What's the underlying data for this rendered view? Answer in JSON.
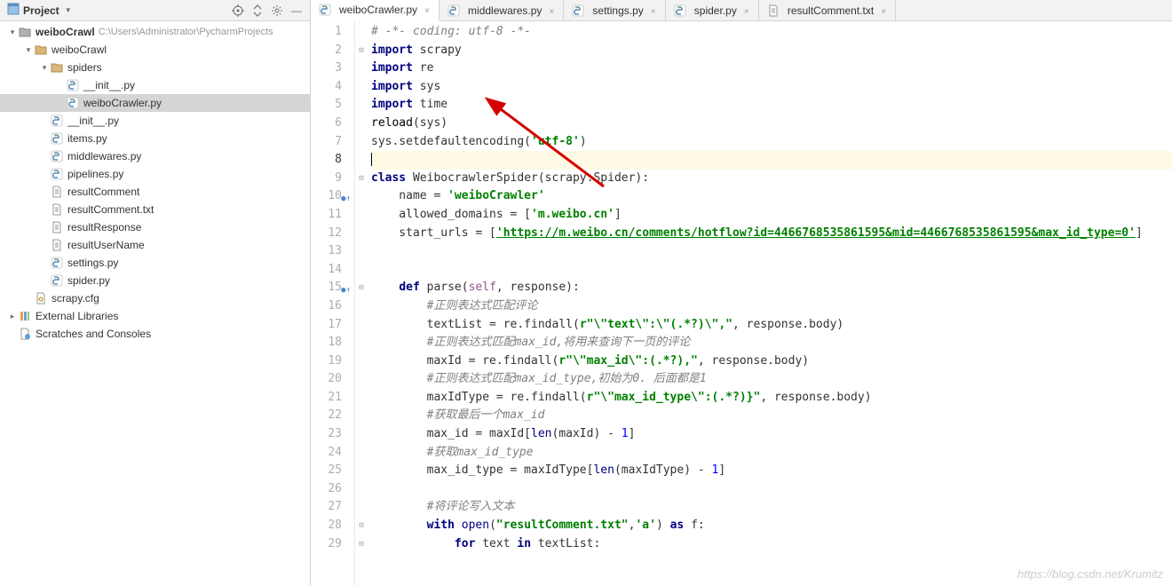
{
  "sidebar": {
    "title": "Project",
    "tree": [
      {
        "indent": 0,
        "twisty": "▾",
        "icon": "folder-root",
        "label": "weiboCrawl",
        "bold": true,
        "path": "C:\\Users\\Administrator\\PycharmProjects"
      },
      {
        "indent": 1,
        "twisty": "▾",
        "icon": "folder",
        "label": "weiboCrawl"
      },
      {
        "indent": 2,
        "twisty": "▾",
        "icon": "folder",
        "label": "spiders"
      },
      {
        "indent": 3,
        "twisty": "",
        "icon": "py",
        "label": "__init__.py"
      },
      {
        "indent": 3,
        "twisty": "",
        "icon": "py",
        "label": "weiboCrawler.py",
        "selected": true
      },
      {
        "indent": 2,
        "twisty": "",
        "icon": "py",
        "label": "__init__.py"
      },
      {
        "indent": 2,
        "twisty": "",
        "icon": "py",
        "label": "items.py"
      },
      {
        "indent": 2,
        "twisty": "",
        "icon": "py",
        "label": "middlewares.py"
      },
      {
        "indent": 2,
        "twisty": "",
        "icon": "py",
        "label": "pipelines.py"
      },
      {
        "indent": 2,
        "twisty": "",
        "icon": "txt",
        "label": "resultComment"
      },
      {
        "indent": 2,
        "twisty": "",
        "icon": "txt",
        "label": "resultComment.txt"
      },
      {
        "indent": 2,
        "twisty": "",
        "icon": "txt",
        "label": "resultResponse"
      },
      {
        "indent": 2,
        "twisty": "",
        "icon": "txt",
        "label": "resultUserName"
      },
      {
        "indent": 2,
        "twisty": "",
        "icon": "py",
        "label": "settings.py"
      },
      {
        "indent": 2,
        "twisty": "",
        "icon": "py",
        "label": "spider.py"
      },
      {
        "indent": 1,
        "twisty": "",
        "icon": "cfg",
        "label": "scrapy.cfg"
      },
      {
        "indent": 0,
        "twisty": "▸",
        "icon": "lib",
        "label": "External Libraries"
      },
      {
        "indent": 0,
        "twisty": "",
        "icon": "scratch",
        "label": "Scratches and Consoles"
      }
    ]
  },
  "tabs": [
    {
      "icon": "py",
      "label": "weiboCrawler.py",
      "active": true
    },
    {
      "icon": "py",
      "label": "middlewares.py"
    },
    {
      "icon": "py",
      "label": "settings.py"
    },
    {
      "icon": "py",
      "label": "spider.py"
    },
    {
      "icon": "txt",
      "label": "resultComment.txt"
    }
  ],
  "code": {
    "current_line": 8,
    "lines": [
      {
        "n": 1,
        "fold": "",
        "html": "<span class='cm'># -*- coding: utf-8 -*-</span>"
      },
      {
        "n": 2,
        "fold": "⊟",
        "html": "<span class='kw'>import</span> scrapy"
      },
      {
        "n": 3,
        "fold": "",
        "html": "<span class='kw'>import</span> re"
      },
      {
        "n": 4,
        "fold": "",
        "html": "<span class='kw'>import</span> sys"
      },
      {
        "n": 5,
        "fold": "",
        "html": "<span class='kw'>import</span> time"
      },
      {
        "n": 6,
        "fold": "",
        "html": "<span class='fn'>reload</span>(sys)"
      },
      {
        "n": 7,
        "fold": "",
        "html": "sys.setdefaultencoding(<span class='str'>'utf-8'</span>)"
      },
      {
        "n": 8,
        "fold": "",
        "html": "<span class='caret'></span>"
      },
      {
        "n": 9,
        "fold": "⊟",
        "html": "<span class='kw'>class</span> WeibocrawlerSpider(scrapy.Spider):"
      },
      {
        "n": 10,
        "fold": "",
        "ov": true,
        "html": "    name = <span class='str'>'weiboCrawler'</span>"
      },
      {
        "n": 11,
        "fold": "",
        "html": "    allowed_domains = [<span class='str'>'m.weibo.cn'</span>]"
      },
      {
        "n": 12,
        "fold": "",
        "html": "    start_urls = [<span class='url'>'https://m.weibo.cn/comments/hotflow?id=4466768535861595&mid=4466768535861595&max_id_type=0'</span>]"
      },
      {
        "n": 13,
        "fold": "",
        "html": ""
      },
      {
        "n": 14,
        "fold": "",
        "html": ""
      },
      {
        "n": 15,
        "fold": "⊟",
        "ov": true,
        "html": "    <span class='kw'>def</span> parse(<span class='self'>self</span>, response):"
      },
      {
        "n": 16,
        "fold": "",
        "html": "        <span class='cm'>#正则表达式匹配评论</span>"
      },
      {
        "n": 17,
        "fold": "",
        "html": "        textList = re.findall(<span class='str'>r\"\\\"text\\\":\\\"(.*?)\\\",\"</span>, response.body)"
      },
      {
        "n": 18,
        "fold": "",
        "html": "        <span class='cm'>#正则表达式匹配max_id,将用来查询下一页的评论</span>"
      },
      {
        "n": 19,
        "fold": "",
        "html": "        maxId = re.findall(<span class='str'>r\"\\\"max_id\\\":(.*?),\"</span>, response.body)"
      },
      {
        "n": 20,
        "fold": "",
        "html": "        <span class='cm'>#正则表达式匹配max_id_type,初始为0. 后面都是1</span>"
      },
      {
        "n": 21,
        "fold": "",
        "html": "        maxIdType = re.findall(<span class='str'>r\"\\\"max_id_type\\\":(.*?)}\"</span>, response.body)"
      },
      {
        "n": 22,
        "fold": "",
        "html": "        <span class='cm'>#获取最后一个max_id</span>"
      },
      {
        "n": 23,
        "fold": "",
        "html": "        max_id = maxId[<span class='bi'>len</span>(maxId) - <span class='num'>1</span>]"
      },
      {
        "n": 24,
        "fold": "",
        "html": "        <span class='cm'>#获取max_id_type</span>"
      },
      {
        "n": 25,
        "fold": "",
        "html": "        max_id_type = maxIdType[<span class='bi'>len</span>(maxIdType) - <span class='num'>1</span>]"
      },
      {
        "n": 26,
        "fold": "",
        "html": ""
      },
      {
        "n": 27,
        "fold": "",
        "html": "        <span class='cm'>#将评论写入文本</span>"
      },
      {
        "n": 28,
        "fold": "⊟",
        "html": "        <span class='kw'>with</span> <span class='bi'>open</span>(<span class='str'>\"resultComment.txt\"</span>,<span class='str'>'a'</span>) <span class='kw'>as</span> f:"
      },
      {
        "n": 29,
        "fold": "⊟",
        "html": "            <span class='kw'>for</span> text <span class='kw'>in</span> textList:"
      }
    ]
  },
  "watermark": "https://blog.csdn.net/Krumitz"
}
